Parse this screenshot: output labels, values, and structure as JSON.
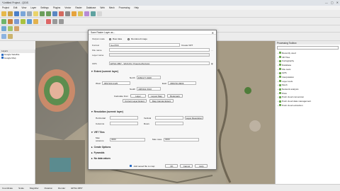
{
  "window": {
    "title": "*Untitled Project - QGIS",
    "controls": [
      "—",
      "▢",
      "✕"
    ]
  },
  "menu": [
    "Project",
    "Edit",
    "View",
    "Layer",
    "Settings",
    "Plugins",
    "Vector",
    "Raster",
    "Database",
    "Web",
    "Mesh",
    "Processing",
    "Help"
  ],
  "layers_panel": {
    "title": "Layers",
    "items": [
      "Google Satellite",
      "Google Map"
    ]
  },
  "processing_toolbox": {
    "title": "Processing Toolbox",
    "items": [
      "Recently used",
      "3D Tiles",
      "Cartography",
      "Database",
      "File tools",
      "GPS",
      "Interpolation",
      "Layer tools",
      "Mesh",
      "Network analysis",
      "Plots",
      "Point cloud conversion",
      "Point cloud data management",
      "Point cloud extraction"
    ]
  },
  "dialog": {
    "title": "Save Raster Layer as...",
    "output_mode_label": "Output mode",
    "raw_data": "Raw data",
    "rendered_image": "Rendered image",
    "format_label": "Format",
    "format_value": "GeoTIFF",
    "create_vrt": "Create VRT",
    "file_name_label": "File name",
    "layer_name_label": "Layer name",
    "crs_label": "CRS",
    "crs_value": "EPSG:3857 - WGS 84 / Pseudo-Mercator",
    "extent_header": "Extent (current: layer)",
    "north_label": "North",
    "north_value": "4084177.0028",
    "west_label": "West",
    "west_value": "-9557200.2425",
    "east_label": "East",
    "east_value": "-9556793.8836",
    "south_label": "South",
    "south_value": "4083911.5916",
    "calc_from": "Calculate from",
    "layer_btn": "Layer",
    "layout_map_btn": "Layout Map",
    "bookmark_btn": "Bookmark",
    "map_canvas_extent": "Current Layer Extent",
    "map_canvas_btn": "Map Canvas Extent",
    "resolution_header": "Resolution (current: layer)",
    "horizontal_label": "Horizontal",
    "vertical_label": "Vertical",
    "columns_label": "Columns",
    "rows_label": "Rows",
    "layer_resolution_btn": "Layer Resolution",
    "vrt_header": "VRT Tiles",
    "max_columns_label": "Max columns",
    "max_columns_value": "3000",
    "max_rows_label": "Max rows",
    "max_rows_value": "3000",
    "creation_options": "Create Options",
    "pyramids": "Pyramids",
    "no_data_values": "No data values",
    "add_to_map": "Add saved file to map",
    "ok": "OK",
    "cancel": "Cancel",
    "help": "Help"
  },
  "status": {
    "coord_label": "Coordinate",
    "scale_label": "Scale",
    "magnifier_label": "Magnifier",
    "rotation_label": "Rotation",
    "render": "Render",
    "crs": "EPSG:3857"
  }
}
